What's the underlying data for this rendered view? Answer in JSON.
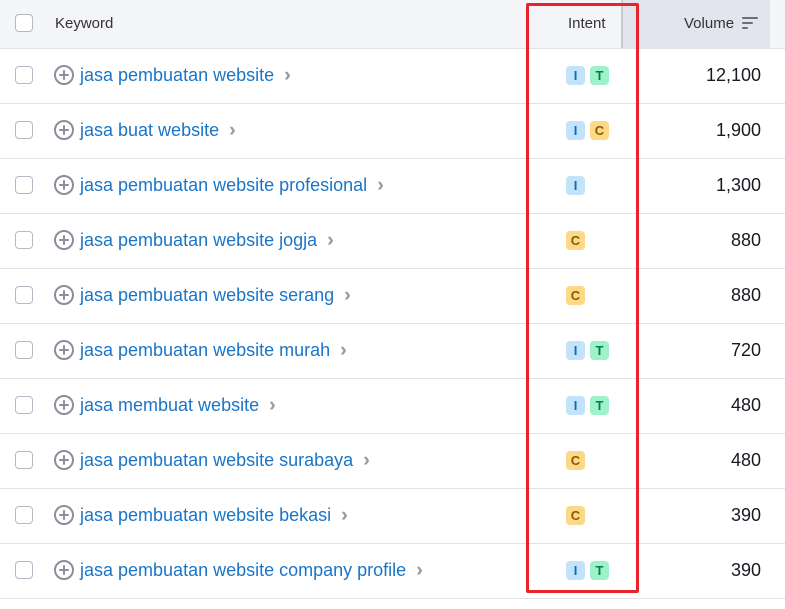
{
  "header": {
    "keyword_label": "Keyword",
    "intent_label": "Intent",
    "volume_label": "Volume"
  },
  "rows": [
    {
      "keyword": "jasa pembuatan website",
      "intents": [
        "I",
        "T"
      ],
      "volume": "12,100"
    },
    {
      "keyword": "jasa buat website",
      "intents": [
        "I",
        "C"
      ],
      "volume": "1,900"
    },
    {
      "keyword": "jasa pembuatan website profesional",
      "intents": [
        "I"
      ],
      "volume": "1,300"
    },
    {
      "keyword": "jasa pembuatan website jogja",
      "intents": [
        "C"
      ],
      "volume": "880"
    },
    {
      "keyword": "jasa pembuatan website serang",
      "intents": [
        "C"
      ],
      "volume": "880"
    },
    {
      "keyword": "jasa pembuatan website murah",
      "intents": [
        "I",
        "T"
      ],
      "volume": "720"
    },
    {
      "keyword": "jasa membuat website",
      "intents": [
        "I",
        "T"
      ],
      "volume": "480"
    },
    {
      "keyword": "jasa pembuatan website surabaya",
      "intents": [
        "C"
      ],
      "volume": "480"
    },
    {
      "keyword": "jasa pembuatan website bekasi",
      "intents": [
        "C"
      ],
      "volume": "390"
    },
    {
      "keyword": "jasa pembuatan website company profile",
      "intents": [
        "I",
        "T"
      ],
      "volume": "390"
    }
  ],
  "colors": {
    "link": "#1a75c8",
    "intent_I": "#c2e3fa",
    "intent_T": "#9ef2c9",
    "intent_C": "#fcd986",
    "highlight": "#e8232b"
  },
  "icons": {
    "add": "plus-circle-icon",
    "open": "double-chevron-right-icon",
    "sort": "sort-descending-icon"
  }
}
